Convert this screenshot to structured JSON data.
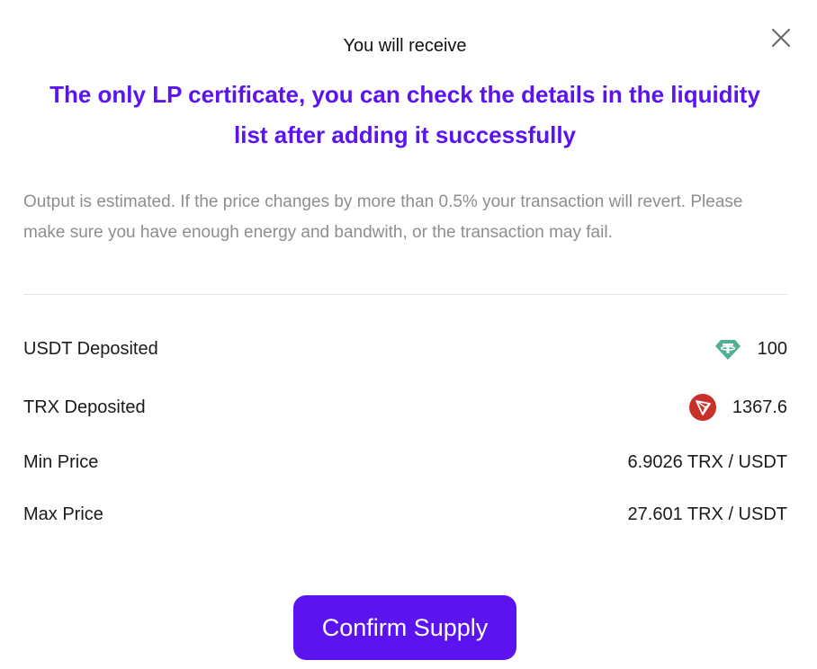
{
  "header": {
    "title": "You will receive"
  },
  "headline": {
    "line1": "The only LP certificate, you can check the details in the liquidity",
    "line2": "list after adding it successfully"
  },
  "notice": {
    "text": "Output is estimated. If the price changes by more than 0.5% your transaction will revert. Please make sure you have enough energy and bandwith, or the transaction may fail."
  },
  "details": {
    "usdt": {
      "label": "USDT Deposited",
      "value": "100",
      "icon": "usdt-tether-icon",
      "color": "#50af95"
    },
    "trx": {
      "label": "TRX Deposited",
      "value": "1367.6",
      "icon": "trx-tron-icon",
      "color": "#c8302a"
    },
    "min_price": {
      "label": "Min Price",
      "value": "6.9026 TRX / USDT"
    },
    "max_price": {
      "label": "Max Price",
      "value": "27.601 TRX / USDT"
    }
  },
  "actions": {
    "confirm_label": "Confirm Supply",
    "close_icon": "close-icon"
  },
  "colors": {
    "accent": "#5b14f0",
    "muted_text": "#8e8e8e"
  }
}
